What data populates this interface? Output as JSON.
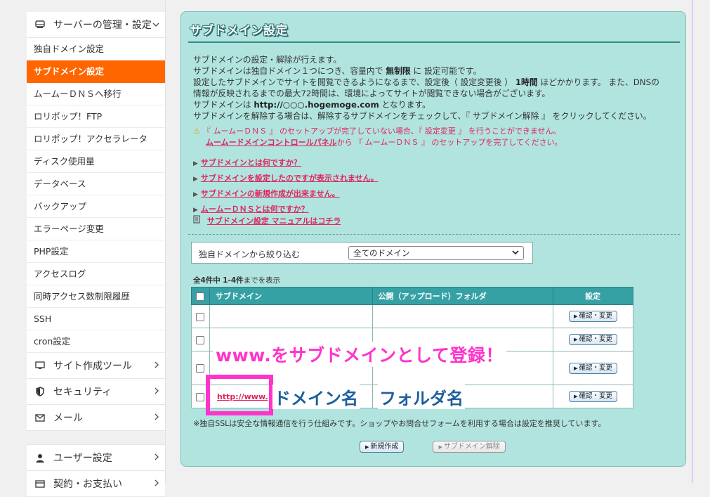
{
  "sidebar": {
    "server_section": "サーバーの管理・設定",
    "server_items": [
      {
        "label": "独自ドメイン設定",
        "active": false
      },
      {
        "label": "サブドメイン設定",
        "active": true
      },
      {
        "label": "ムームーＤＮＳへ移行",
        "active": false
      },
      {
        "label": "ロリポップ！FTP",
        "active": false
      },
      {
        "label": "ロリポップ！アクセラレータ",
        "active": false
      },
      {
        "label": "ディスク使用量",
        "active": false
      },
      {
        "label": "データベース",
        "active": false
      },
      {
        "label": "バックアップ",
        "active": false
      },
      {
        "label": "エラーページ変更",
        "active": false
      },
      {
        "label": "PHP設定",
        "active": false
      },
      {
        "label": "アクセスログ",
        "active": false
      },
      {
        "label": "同時アクセス数制限履歴",
        "active": false
      },
      {
        "label": "SSH",
        "active": false
      },
      {
        "label": "cron設定",
        "active": false
      }
    ],
    "site_tools": "サイト作成ツール",
    "security": "セキュリティ",
    "mail": "メール",
    "user_settings": "ユーザー設定",
    "contract": "契約・お支払い"
  },
  "panel": {
    "title": "サブドメイン設定",
    "desc": {
      "l1": "サブドメインの設定・解除が行えます。",
      "l2a": "サブドメインは独自ドメイン１つにつき、容量内で",
      "l2b": "無制限",
      "l2c": "に 設定可能です。",
      "l3a": "設定したサブドメインでサイトを閲覧できるようになるまで、設定後（ 設定変更後 ）",
      "l3b": "1時間",
      "l3c": "ほどかかります。 また、DNSの",
      "l4": "情報が反映されるまでの最大72時間は、環境によってサイトが閲覧できない場合がございます。",
      "l5a": "サブドメインは",
      "l5b": "http://○○○.hogemoge.com",
      "l5c": "となります。",
      "l6": "サブドメインを解除する場合は、解除するサブドメインをチェックして、『 サブドメイン解除 』 をクリックしてください。"
    },
    "warning": {
      "l1": "『 ムームーＤＮＳ 』 のセットアップが完了していない場合、『 設定変更 』 を行うことができません。",
      "link": "ムームードメインコントロールパネル",
      "l2": "から 『 ムームーＤＮＳ 』 のセットアップを完了してください。"
    },
    "faq": [
      "サブドメインとは何ですか？",
      "サブドメインを設定したのですが表示されません。",
      "サブドメインの新規作成が出来ません。",
      "ムームーＤＮＳとは何ですか？"
    ],
    "manual": "サブドメイン設定 マニュアルはコチラ",
    "filter": {
      "label": "独自ドメインから絞り込む",
      "selected": "全てのドメイン"
    },
    "count": {
      "a": "全4件中",
      "b": "1-4件",
      "c": "までを表示"
    },
    "table": {
      "headers": {
        "subdomain": "サブドメイン",
        "folder": "公開（アップロード）フォルダ",
        "setting": "設定"
      },
      "rows": [
        {
          "subdomain": "",
          "folder": "",
          "button": "確認・変更"
        },
        {
          "subdomain": "",
          "folder": "",
          "button": "確認・変更"
        },
        {
          "subdomain": "",
          "folder": "",
          "button": "確認・変更"
        },
        {
          "subdomain": "http://www.",
          "folder": "",
          "button": "確認・変更"
        }
      ]
    },
    "note": "※独自SSLは安全な情報通信を行う仕組みです。ショップやお問合せフォームを利用する場合は設定を推奨しています。",
    "buttons": {
      "new": "新規作成",
      "remove": "サブドメイン解除"
    }
  },
  "annotations": {
    "headline": "www.をサブドメインとして登録！",
    "domain": "ドメイン名",
    "folder": "フォルダ名"
  },
  "colors": {
    "accent": "#ff6600",
    "panel": "#b1e4df",
    "header": "#36a1a5",
    "link": "#e0245e",
    "annotation": "#ff33cc"
  }
}
